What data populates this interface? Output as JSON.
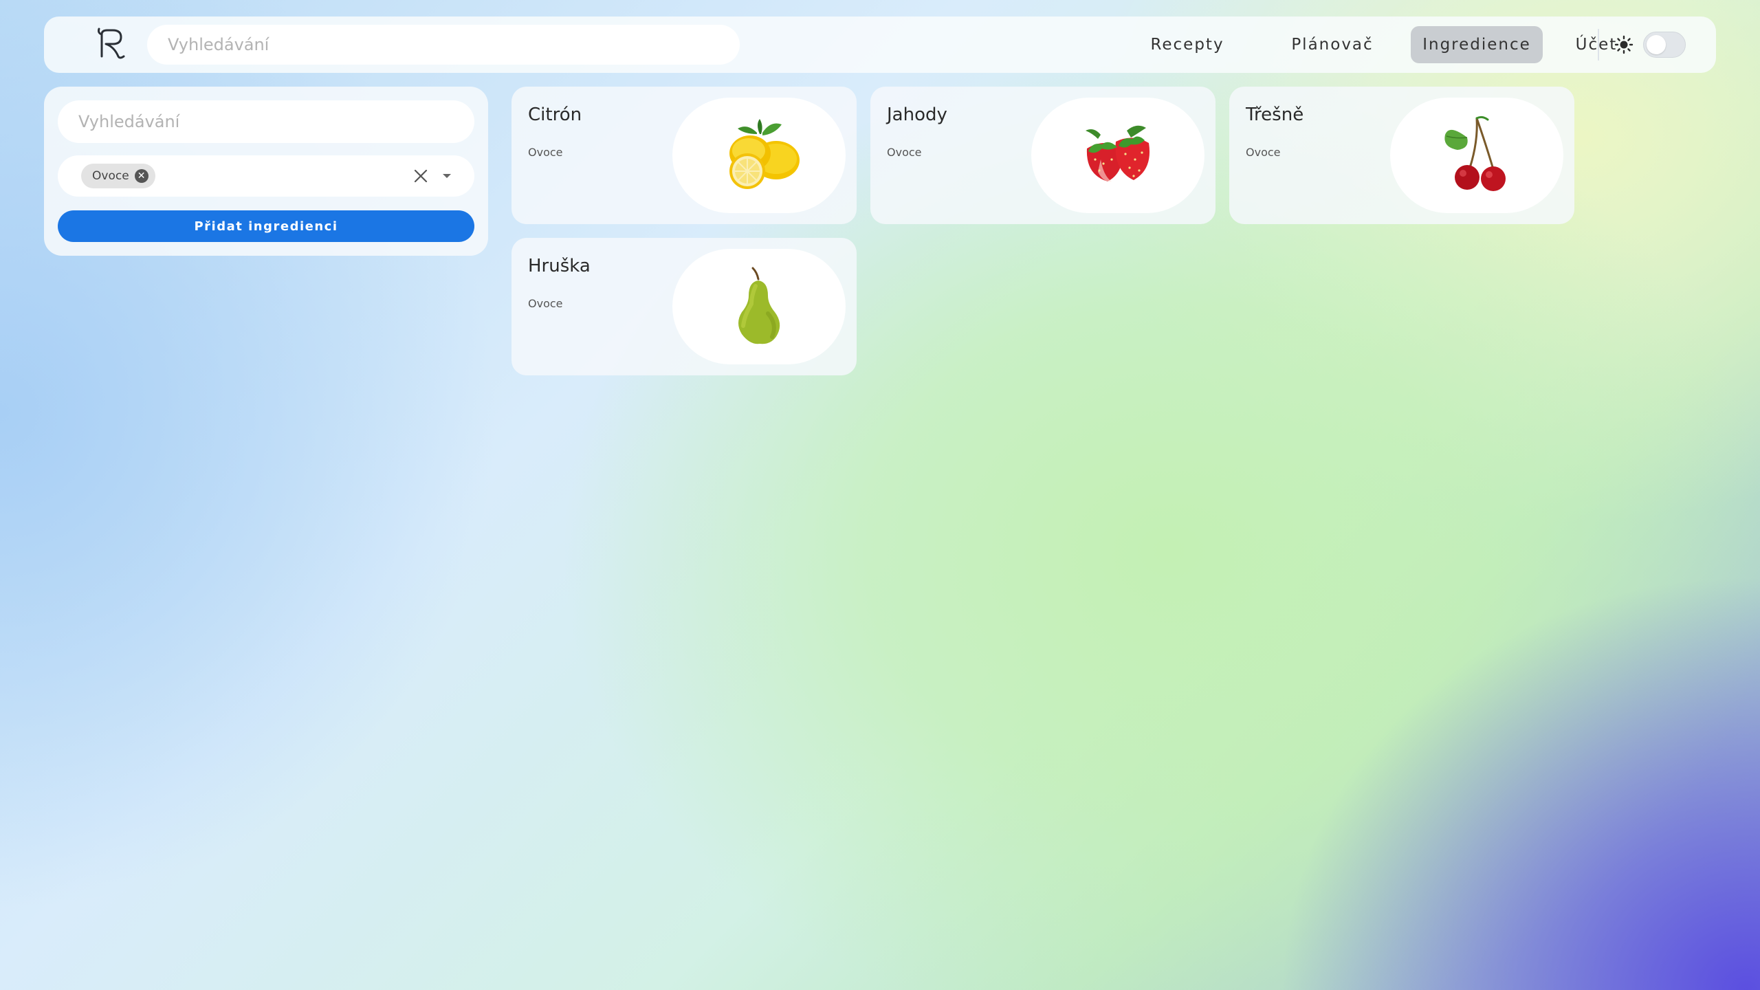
{
  "header": {
    "logo_letter": "R",
    "search_placeholder": "Vyhledávání",
    "nav": [
      {
        "label": "Recepty",
        "active": false
      },
      {
        "label": "Plánovač",
        "active": false
      },
      {
        "label": "Ingredience",
        "active": true
      },
      {
        "label": "Účet",
        "active": false
      }
    ],
    "theme_icon": "sun-icon",
    "theme_toggle_on": false
  },
  "sidebar": {
    "search_placeholder": "Vyhledávání",
    "filter_chips": [
      "Ovoce"
    ],
    "add_button_label": "Přidat ingredienci"
  },
  "ingredients": [
    {
      "name": "Citrón",
      "category": "Ovoce",
      "image": "lemon"
    },
    {
      "name": "Jahody",
      "category": "Ovoce",
      "image": "strawberries"
    },
    {
      "name": "Třešně",
      "category": "Ovoce",
      "image": "cherries"
    },
    {
      "name": "Hruška",
      "category": "Ovoce",
      "image": "pear"
    }
  ],
  "colors": {
    "primary_button": "#1b76e4",
    "active_nav": "#c9cdd1"
  }
}
